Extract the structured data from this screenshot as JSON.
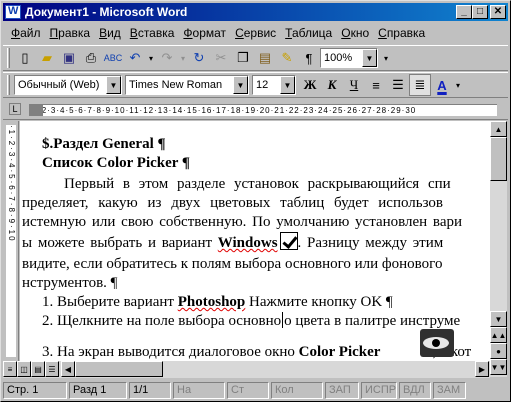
{
  "window": {
    "title": "Документ1 - Microsoft Word"
  },
  "menu": [
    "Файл",
    "Правка",
    "Вид",
    "Вставка",
    "Формат",
    "Сервис",
    "Таблица",
    "Окно",
    "Справка"
  ],
  "toolbar": {
    "zoom": "100%"
  },
  "formatting": {
    "style": "Обычный (Web)",
    "font": "Times New Roman",
    "size": "12",
    "bold": "Ж",
    "italic": "К",
    "underline": "Ч",
    "fontcolor": "A"
  },
  "document": {
    "heading1": "$.Раздел General ¶",
    "heading2": "Список Color Picker ¶",
    "line1": "Первый в этом разделе установок раскрывающийся спи",
    "line2": "пределяет, какую из двух цветовых таблиц будет использов",
    "line3": "истемную или свою собственную. По умолчанию установлен вари",
    "line4a": "ы можете выбрать и вариант ",
    "line4b": "Windows",
    "line4c": ". Разницу между этим",
    "line5": "видите, если обратитесь к полям выбора основного или фонового",
    "line6": "нструментов. ¶",
    "line7a": "1. Выберите вариант ",
    "line7b": "Photoshop",
    "line7c": " Нажмите кнопку OK ¶",
    "line8a": "2. Щелкните на поле выбора основно",
    "line8b": "о цвета в палитре инструме",
    "line9a": "3. На экран выводится диалоговое окно ",
    "line9b": "Color Picker",
    "line9c": ", в кот"
  },
  "status": {
    "page": "Стр. 1",
    "section": "Разд 1",
    "pages": "1/1",
    "at": "На",
    "line": "Ст",
    "col": "Кол",
    "rec": "ЗАП",
    "trk": "ИСПР",
    "ext": "ВДЛ",
    "ovr": "ЗАМ"
  }
}
